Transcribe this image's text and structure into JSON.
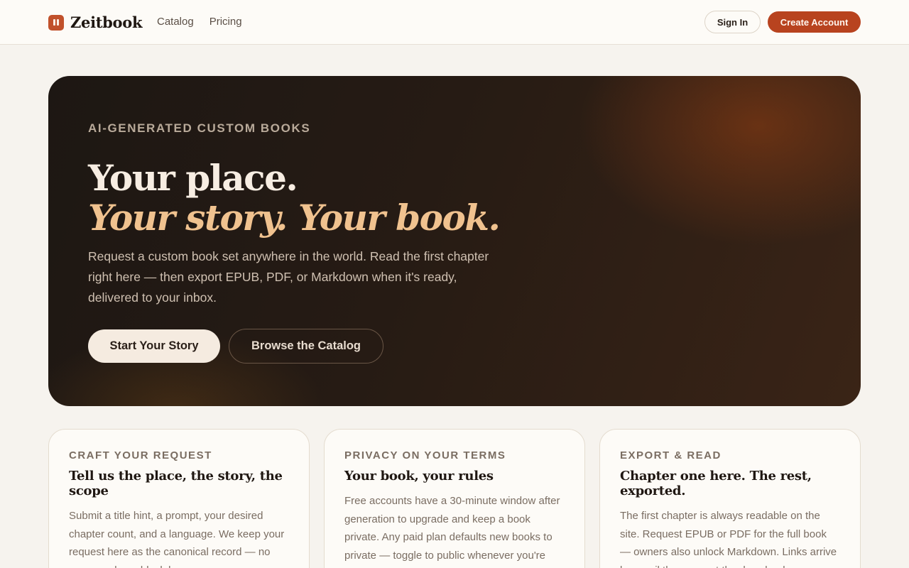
{
  "brand": {
    "name": "Zeitbook",
    "accent": "#b8431f"
  },
  "nav": [
    {
      "label": "Catalog"
    },
    {
      "label": "Pricing"
    }
  ],
  "header_actions": {
    "signin_label": "Sign In",
    "create_label": "Create Account"
  },
  "hero": {
    "eyebrow": "AI-GENERATED CUSTOM BOOKS",
    "title_line1": "Your place.",
    "title_line2": "Your story. Your book.",
    "subtitle": "Request a custom book set anywhere in the world. Read the first chapter right here — then export EPUB, PDF, or Markdown when it's ready, delivered to your inbox.",
    "primary_cta": "Start Your Story",
    "secondary_cta": "Browse the Catalog"
  },
  "features": [
    {
      "eyebrow": "CRAFT YOUR REQUEST",
      "title": "Tell us the place, the story, the scope",
      "body": "Submit a title hint, a prompt, your desired chapter count, and a language. We keep your request here as the canonical record — no guesswork, no black box."
    },
    {
      "eyebrow": "PRIVACY ON YOUR TERMS",
      "title": "Your book, your rules",
      "body": "Free accounts have a 30-minute window after generation to upgrade and keep a book private. Any paid plan defaults new books to private — toggle to public whenever you're"
    },
    {
      "eyebrow": "EXPORT & READ",
      "title": "Chapter one here. The rest, exported.",
      "body": "The first chapter is always readable on the site. Request EPUB or PDF for the full book — owners also unlock Markdown. Links arrive by email the moment the download"
    }
  ]
}
